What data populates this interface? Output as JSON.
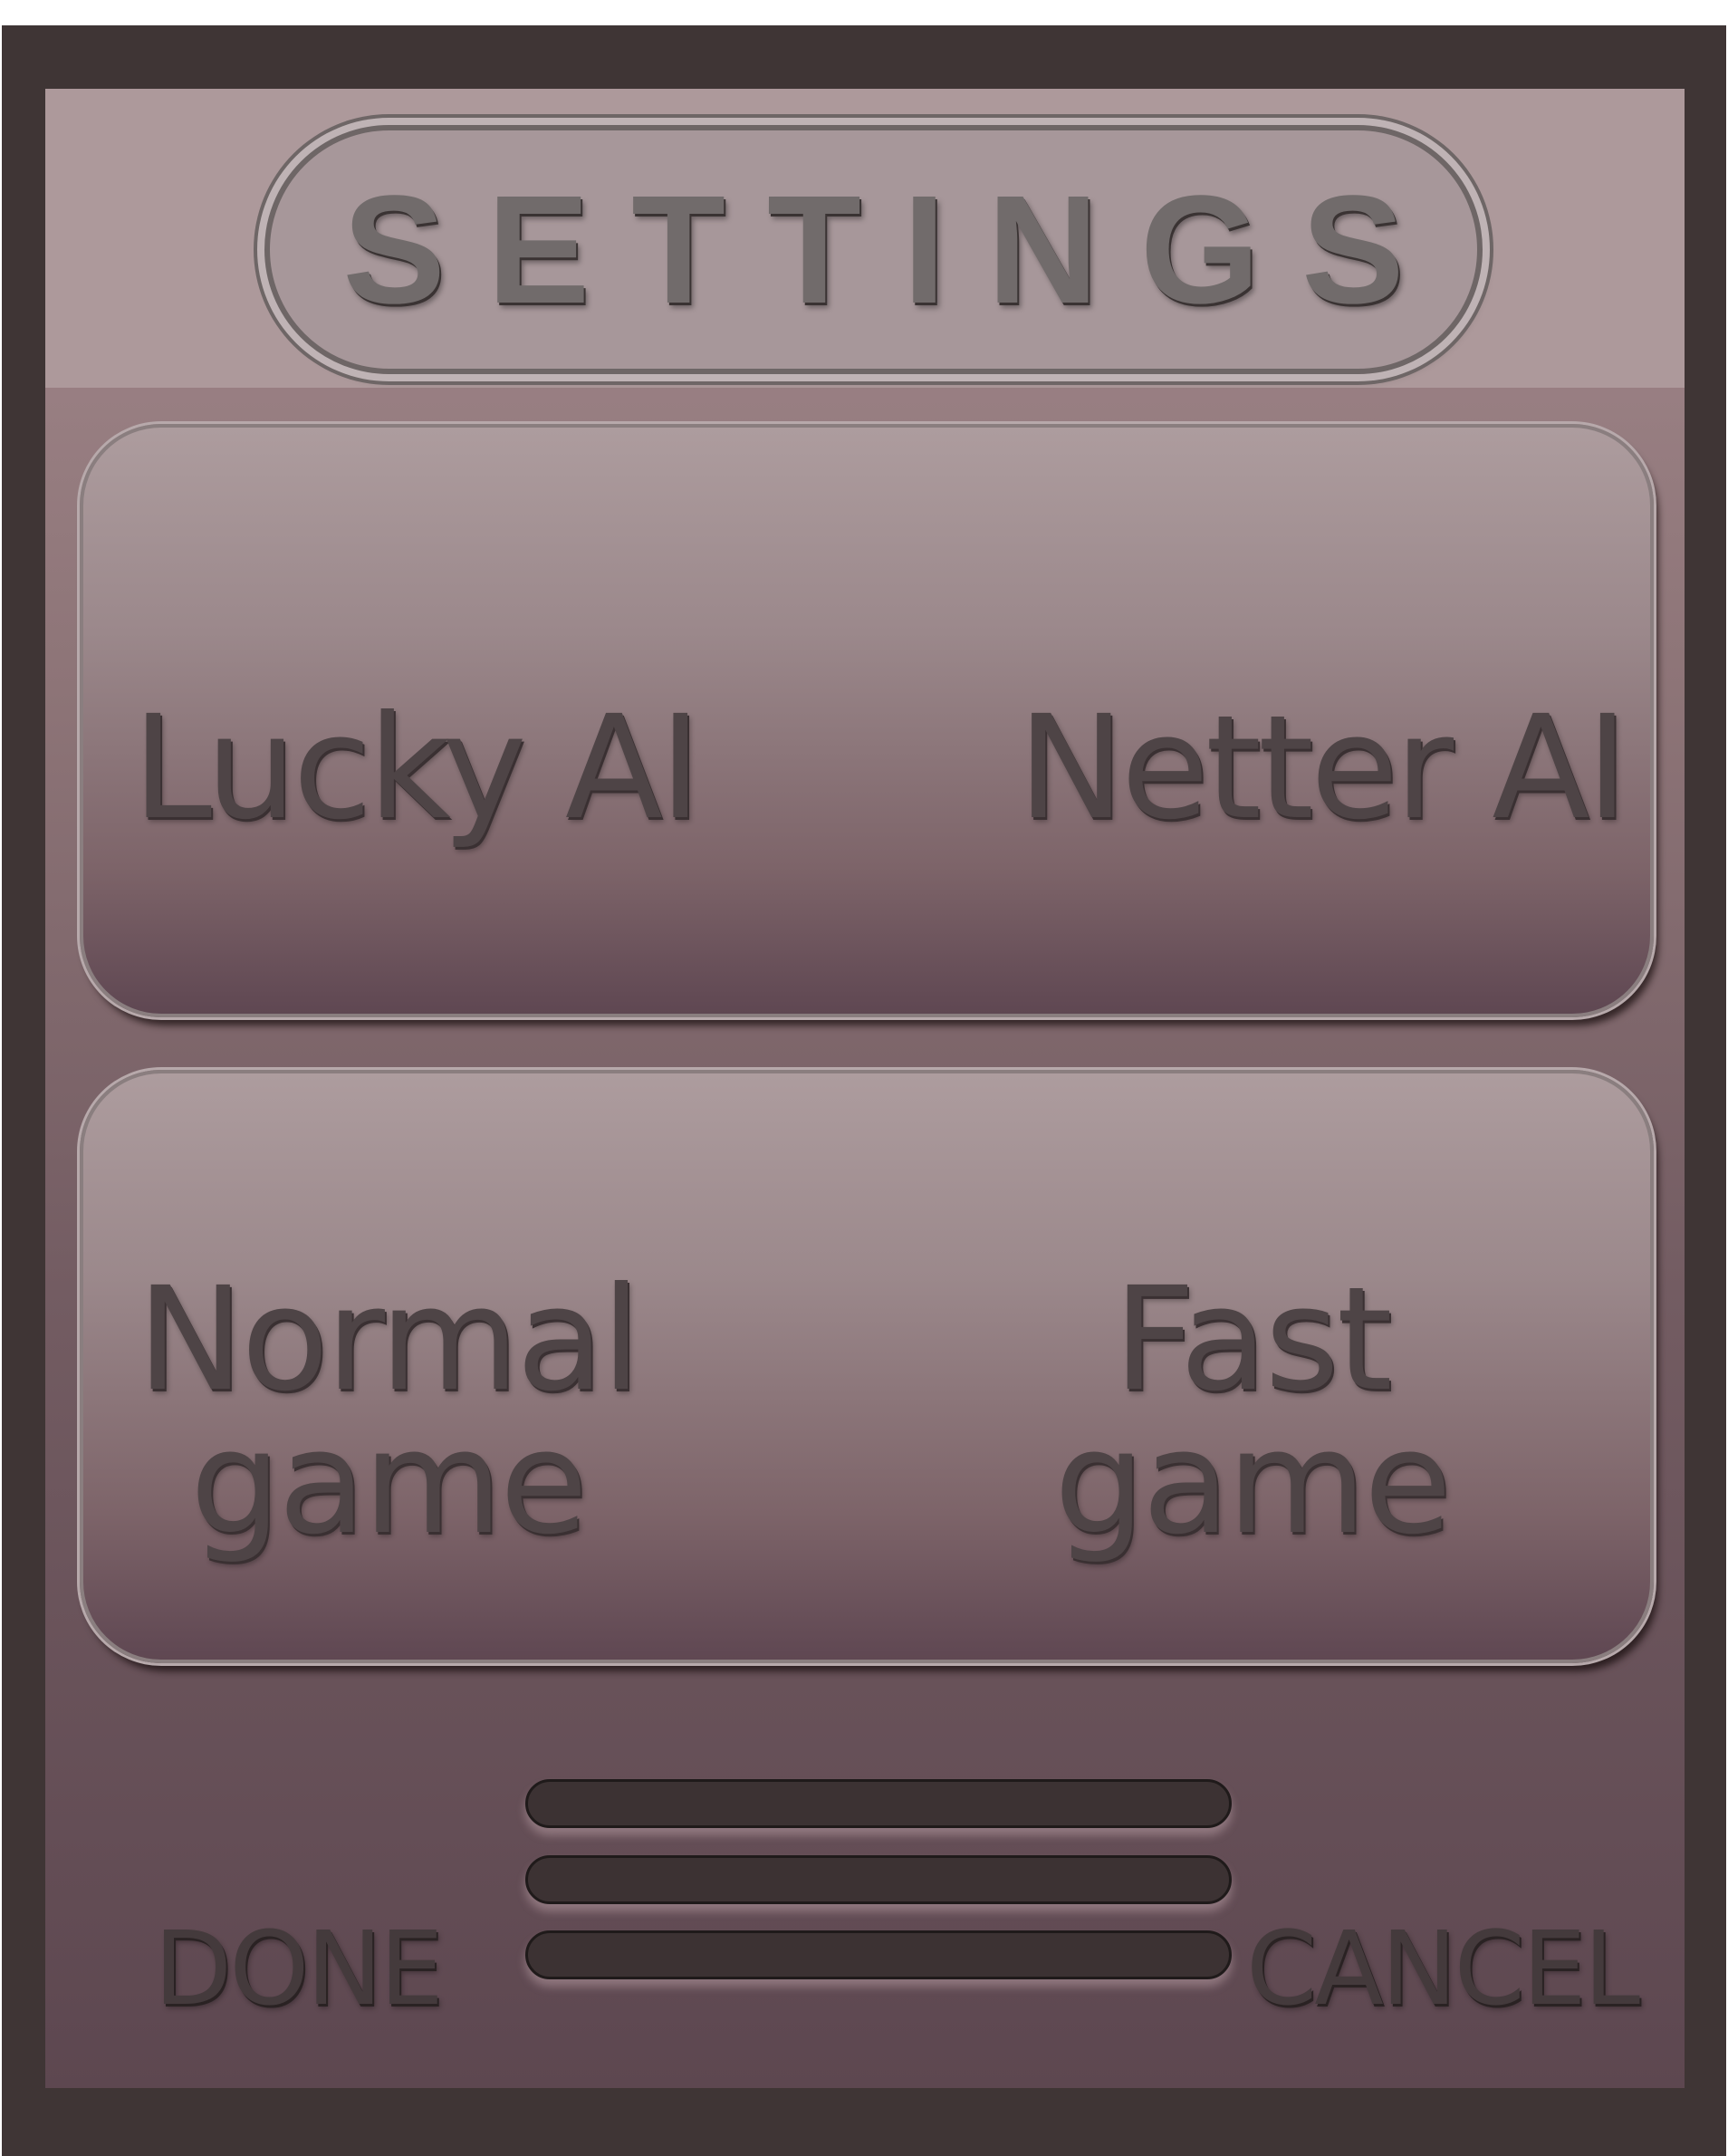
{
  "title": "SETTINGS",
  "ai_options": {
    "left": "Lucky AI",
    "right": "Netter AI"
  },
  "game_options": {
    "left_line1": "Normal",
    "left_line2": "game",
    "right_line1": "Fast",
    "right_line2": "game"
  },
  "menu_icon": "hamburger-menu-icon",
  "actions": {
    "done": "DONE",
    "cancel": "CANCEL"
  },
  "colors": {
    "frame": "#3f3535",
    "text": "#4e4446",
    "bars": "#3c3233"
  }
}
